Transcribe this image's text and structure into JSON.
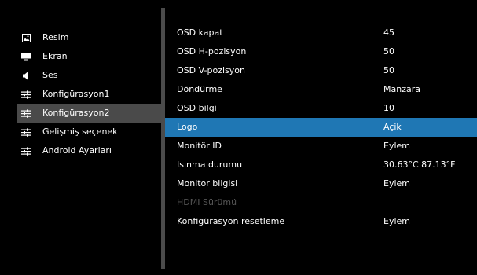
{
  "sidebar": {
    "items": [
      {
        "label": "Resim",
        "icon": "picture-icon",
        "active": false
      },
      {
        "label": "Ekran",
        "icon": "display-icon",
        "active": false
      },
      {
        "label": "Ses",
        "icon": "speaker-icon",
        "active": false
      },
      {
        "label": "Konfigürasyon1",
        "icon": "settings-sliders-icon",
        "active": false
      },
      {
        "label": "Konfigürasyon2",
        "icon": "settings-sliders-icon",
        "active": true
      },
      {
        "label": "Gelişmiş seçenek",
        "icon": "settings-sliders-icon",
        "active": false
      },
      {
        "label": "Android Ayarları",
        "icon": "settings-sliders-icon",
        "active": false
      }
    ]
  },
  "settings": {
    "rows": [
      {
        "label": "OSD kapat",
        "value": "45",
        "state": "normal"
      },
      {
        "label": "OSD H-pozisyon",
        "value": "50",
        "state": "normal"
      },
      {
        "label": "OSD V-pozisyon",
        "value": "50",
        "state": "normal"
      },
      {
        "label": "Döndürme",
        "value": "Manzara",
        "state": "normal"
      },
      {
        "label": "OSD bilgi",
        "value": "10",
        "state": "normal"
      },
      {
        "label": "Logo",
        "value": "Açik",
        "state": "selected"
      },
      {
        "label": "Monitör ID",
        "value": "Eylem",
        "state": "normal"
      },
      {
        "label": "Isınma durumu",
        "value": "30.63°C 87.13°F",
        "state": "normal"
      },
      {
        "label": "Monitor bilgisi",
        "value": "Eylem",
        "state": "normal"
      },
      {
        "label": "HDMI Sürümü",
        "value": "",
        "state": "disabled"
      },
      {
        "label": "Konfigürasyon resetleme",
        "value": "Eylem",
        "state": "normal"
      }
    ]
  },
  "colors": {
    "background": "#000000",
    "selection": "#1f77b4",
    "sidebar_active": "#4a4a4a",
    "divider": "#4b4b4b",
    "disabled_text": "#555555"
  }
}
